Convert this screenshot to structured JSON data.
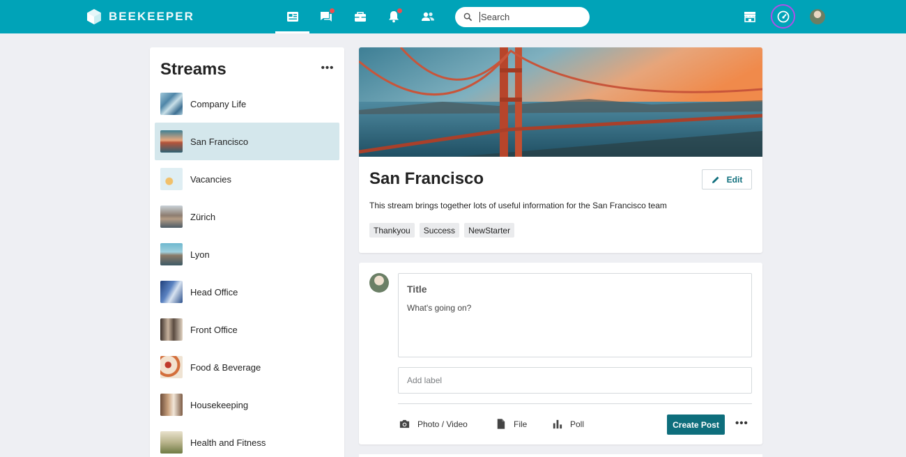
{
  "app": {
    "name": "BEEKEEPER"
  },
  "nav": {
    "icons": [
      "news-feed-icon",
      "chat-icon",
      "tools-icon",
      "notifications-icon",
      "people-icon"
    ],
    "chat_badge": true,
    "notifications_badge": true
  },
  "search": {
    "placeholder": "Search"
  },
  "header_right": {
    "icons": [
      "store-icon",
      "dashboard-speed-icon",
      "user-avatar"
    ]
  },
  "sidebar": {
    "title": "Streams",
    "items": [
      {
        "label": "Company Life"
      },
      {
        "label": "San Francisco",
        "active": true
      },
      {
        "label": "Vacancies"
      },
      {
        "label": "Zürich"
      },
      {
        "label": "Lyon"
      },
      {
        "label": "Head Office"
      },
      {
        "label": "Front Office"
      },
      {
        "label": "Food & Beverage"
      },
      {
        "label": "Housekeeping"
      },
      {
        "label": "Health and Fitness"
      }
    ]
  },
  "stream": {
    "title": "San Francisco",
    "edit_label": "Edit",
    "description": "This stream brings together lots of useful information for the San Francisco team",
    "tags": [
      "Thankyou",
      "Success",
      "NewStarter"
    ]
  },
  "composer": {
    "title_placeholder": "Title",
    "body_placeholder": "What's going on?",
    "label_placeholder": "Add label",
    "actions": {
      "photo": "Photo / Video",
      "file": "File",
      "poll": "Poll"
    },
    "create_label": "Create Post"
  },
  "colors": {
    "topbar": "#00a3b8",
    "primary_button": "#0e6e7c",
    "active_stream": "#d4e7ec",
    "badge": "#f04d4d",
    "highlight_ring": "#b14ee8"
  }
}
